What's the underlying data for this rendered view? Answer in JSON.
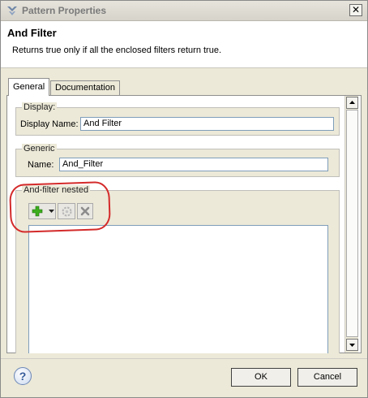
{
  "window": {
    "title": "Pattern Properties",
    "close_glyph": "✕"
  },
  "header": {
    "title": "And Filter",
    "description": "Returns true only if all the enclosed filters return true."
  },
  "tabs": [
    {
      "label": "General",
      "active": true
    },
    {
      "label": "Documentation",
      "active": false
    }
  ],
  "display_group": {
    "legend": "Display:",
    "field_label": "Display Name:",
    "field_value": "And Filter"
  },
  "generic_group": {
    "legend": "Generic",
    "field_label": "Name:",
    "field_value": "And_Filter"
  },
  "nested_group": {
    "legend": "And-filter nested",
    "toolbar": {
      "icons": [
        "add-icon",
        "dropdown-arrow-icon",
        "edit-icon",
        "delete-icon"
      ]
    }
  },
  "footer": {
    "help_glyph": "?",
    "ok_label": "OK",
    "cancel_label": "Cancel"
  },
  "colors": {
    "annotation": "#d42a2a",
    "add_icon": "#3cae1e"
  }
}
